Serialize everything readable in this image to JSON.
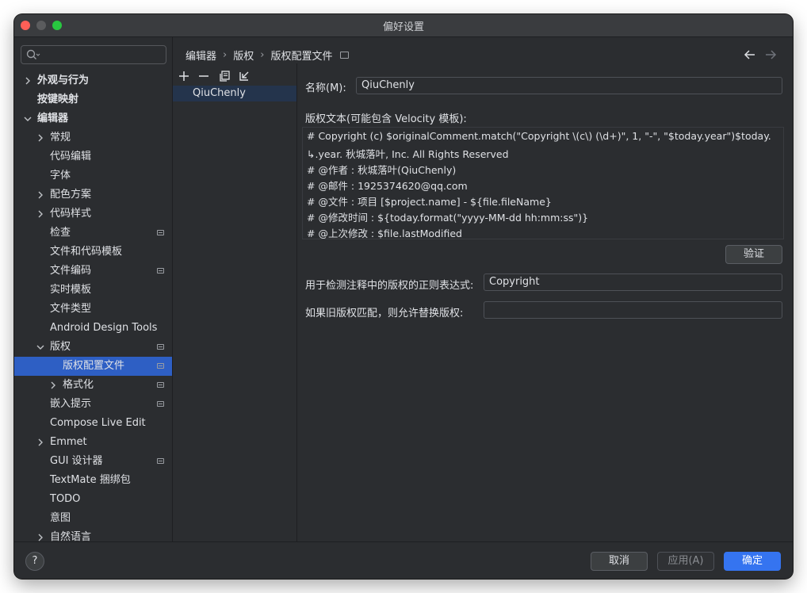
{
  "window": {
    "title": "偏好设置"
  },
  "search": {
    "placeholder": ""
  },
  "sidebar": {
    "items": [
      {
        "label": "外观与行为",
        "chevron": "right",
        "bold": true
      },
      {
        "label": "按键映射",
        "bold": true
      },
      {
        "label": "编辑器",
        "chevron": "down",
        "bold": true
      },
      {
        "label": "常规",
        "chevron": "right"
      },
      {
        "label": "代码编辑"
      },
      {
        "label": "字体"
      },
      {
        "label": "配色方案",
        "chevron": "right"
      },
      {
        "label": "代码样式",
        "chevron": "right"
      },
      {
        "label": "检查",
        "badge": true
      },
      {
        "label": "文件和代码模板"
      },
      {
        "label": "文件编码",
        "badge": true
      },
      {
        "label": "实时模板"
      },
      {
        "label": "文件类型"
      },
      {
        "label": "Android Design Tools"
      },
      {
        "label": "版权",
        "chevron": "down",
        "badge": true
      },
      {
        "label": "版权配置文件",
        "badge": true,
        "selected": true
      },
      {
        "label": "格式化",
        "chevron": "right",
        "badge": true
      },
      {
        "label": "嵌入提示",
        "badge": true
      },
      {
        "label": "Compose Live Edit"
      },
      {
        "label": "Emmet",
        "chevron": "right"
      },
      {
        "label": "GUI 设计器",
        "badge": true
      },
      {
        "label": "TextMate 捆绑包"
      },
      {
        "label": "TODO"
      },
      {
        "label": "意图"
      },
      {
        "label": "自然语言",
        "chevron": "right"
      }
    ]
  },
  "breadcrumb": {
    "items": [
      "编辑器",
      "版权",
      "版权配置文件"
    ],
    "separator": "›"
  },
  "profiles": {
    "items": [
      "QiuChenly"
    ]
  },
  "form": {
    "name_label": "名称(M):",
    "name_value": "QiuChenly",
    "text_label": "版权文本(可能包含 Velocity 模板):",
    "text_lines": [
      "# Copyright (c) $originalComment.match(\"Copyright \\(c\\) (\\d+)\", 1, \"-\", \"$today.year\")$today.",
      "↳.year. 秋城落叶, Inc. All Rights Reserved",
      "# @作者         : 秋城落叶(QiuChenly)",
      "# @邮件         : 1925374620@qq.com",
      "# @文件         : 项目 [$project.name] - ${file.fileName}",
      "# @修改时间    : ${today.format(\"yyyy-MM-dd hh:mm:ss\")}",
      "# @上次修改    : $file.lastModified"
    ],
    "validate_label": "验证",
    "regex_label": "用于检测注释中的版权的正则表达式:",
    "regex_value": "Copyright",
    "replace_label": "如果旧版权匹配，则允许替换版权:",
    "replace_value": ""
  },
  "footer": {
    "help_label": "?",
    "cancel_label": "取消",
    "apply_label": "应用(A)",
    "ok_label": "确定"
  },
  "colors": {
    "background": "#2b2d30",
    "selection": "#2e5fc4",
    "primary_button": "#3574f0"
  }
}
